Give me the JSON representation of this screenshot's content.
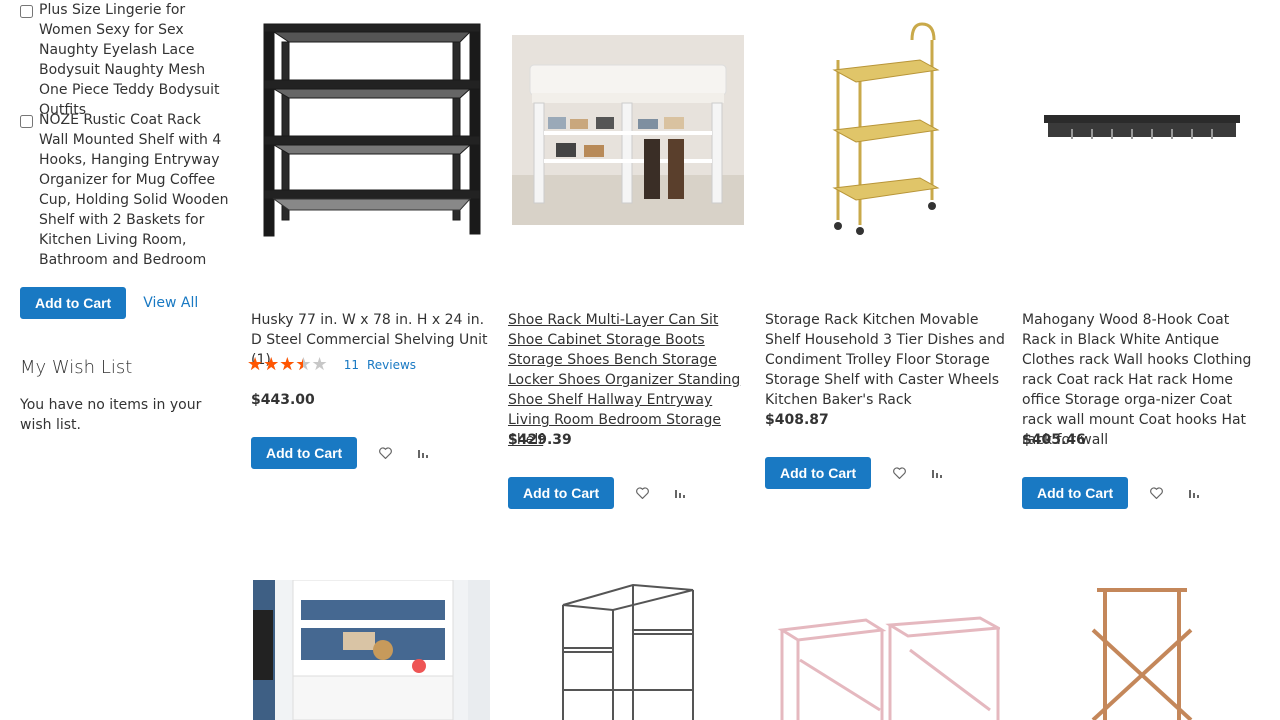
{
  "compare": {
    "items": [
      {
        "name": "Plus Size Lingerie for Women Sexy for Sex Naughty Eyelash Lace Bodysuit Naughty Mesh One Piece Teddy Bodysuit Outfits"
      },
      {
        "name": "NOZE Rustic Coat Rack Wall Mounted Shelf with 4 Hooks, Hanging Entryway Organizer for Mug Coffee Cup, Holding Solid Wooden Shelf with 2 Baskets for Kitchen Living Room, Bathroom and Bedroom"
      }
    ],
    "add_to_cart_label": "Add to Cart",
    "view_all_label": "View All"
  },
  "wishlist": {
    "title": "My Wish List",
    "empty_text": "You have no items in your wish list."
  },
  "products": [
    {
      "name": "Husky 77 in. W x 78 in. H x 24 in. D Steel Commercial Shelving Unit (1)",
      "rating_percent": 70,
      "reviews_count": "11",
      "reviews_label": "Reviews",
      "price": "$443.00",
      "add_to_cart_label": "Add to Cart"
    },
    {
      "name": "Shoe Rack Multi-Layer Can Sit Shoe Cabinet Storage Boots Storage Shoes Bench Storage Locker Shoes Organizer Standing Shoe Shelf Hallway Entryway Living Room Bedroom Storage Shelf",
      "price": "$429.39",
      "add_to_cart_label": "Add to Cart"
    },
    {
      "name": "Storage Rack Kitchen Movable Shelf Household 3 Tier Dishes and Condiment Trolley Floor Storage Storage Shelf with Caster Wheels Kitchen Baker's Rack",
      "price": "$408.87",
      "add_to_cart_label": "Add to Cart"
    },
    {
      "name": "Mahogany Wood 8-Hook Coat Rack in Black White Antique Clothes rack Wall hooks Clothing rack Coat rack Hat rack Home office Storage orga-nizer Coat rack wall mount Coat hooks Hat rack for wall",
      "price": "$405.46",
      "add_to_cart_label": "Add to Cart"
    }
  ],
  "colors": {
    "primary": "#1979c3",
    "star": "#ff5501",
    "star_empty": "#c7c7c7"
  }
}
